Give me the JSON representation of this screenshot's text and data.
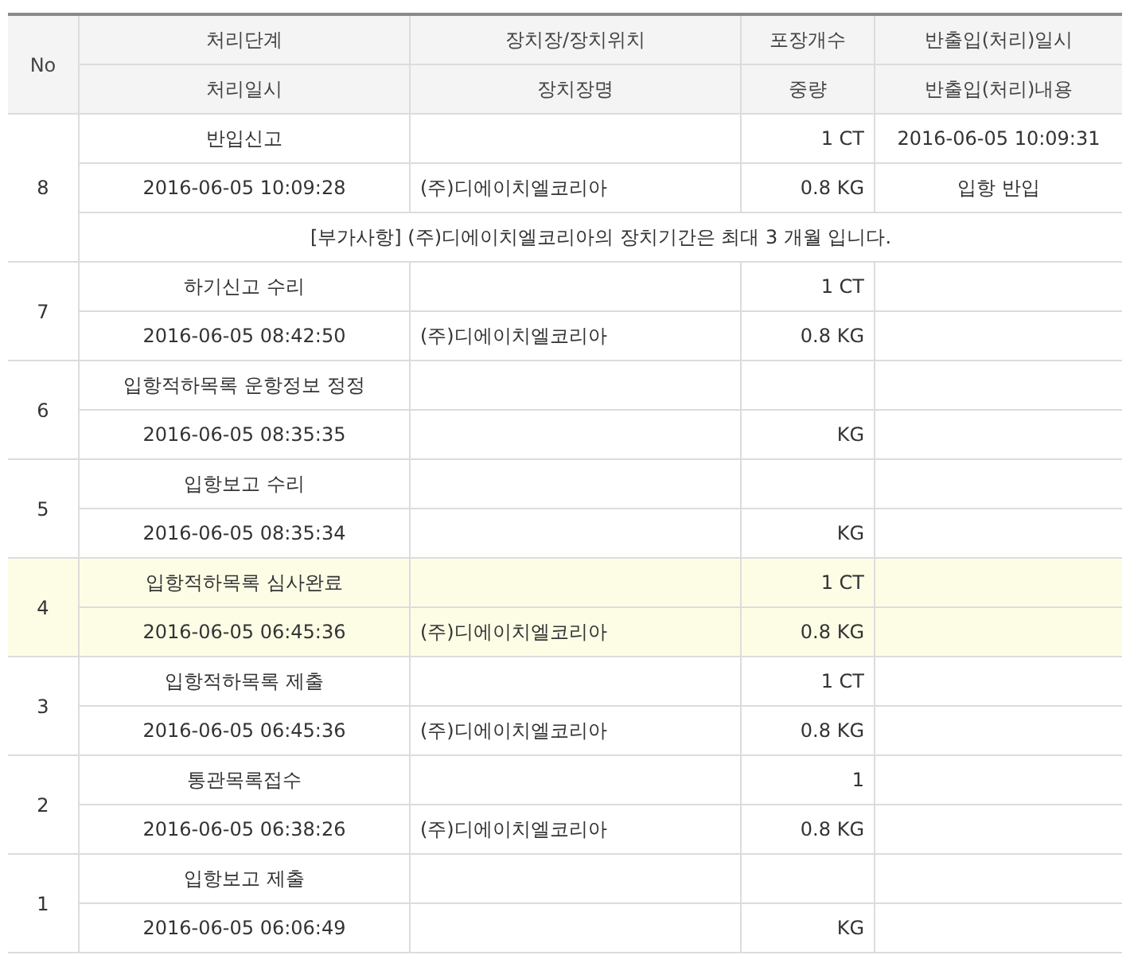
{
  "header": {
    "no": "No",
    "row1": [
      "처리단계",
      "장치장/장치위치",
      "포장개수",
      "반출입(처리)일시"
    ],
    "row2": [
      "처리일시",
      "장치장명",
      "중량",
      "반출입(처리)내용"
    ]
  },
  "rows": [
    {
      "no": "8",
      "stage": "반입신고",
      "time": "2016-06-05 10:09:28",
      "warehouse": "(주)디에이치엘코리아",
      "count": "1 CT",
      "weight": "0.8 KG",
      "io_time": "2016-06-05 10:09:31",
      "io_content": "입항 반입",
      "note": "[부가사항] (주)디에이치엘코리아의 장치기간은 최대 3 개월 입니다.",
      "highlighted": false
    },
    {
      "no": "7",
      "stage": "하기신고 수리",
      "time": "2016-06-05 08:42:50",
      "warehouse": "(주)디에이치엘코리아",
      "count": "1 CT",
      "weight": "0.8 KG",
      "highlighted": false
    },
    {
      "no": "6",
      "stage": "입항적하목록 운항정보 정정",
      "time": "2016-06-05 08:35:35",
      "weight": "KG",
      "highlighted": false
    },
    {
      "no": "5",
      "stage": "입항보고 수리",
      "time": "2016-06-05 08:35:34",
      "weight": "KG",
      "highlighted": false
    },
    {
      "no": "4",
      "stage": "입항적하목록 심사완료",
      "time": "2016-06-05 06:45:36",
      "warehouse": "(주)디에이치엘코리아",
      "count": "1 CT",
      "weight": "0.8 KG",
      "highlighted": true
    },
    {
      "no": "3",
      "stage": "입항적하목록 제출",
      "time": "2016-06-05 06:45:36",
      "warehouse": "(주)디에이치엘코리아",
      "count": "1 CT",
      "weight": "0.8 KG",
      "highlighted": false
    },
    {
      "no": "2",
      "stage": "통관목록접수",
      "time": "2016-06-05 06:38:26",
      "warehouse": "(주)디에이치엘코리아",
      "count": "1",
      "weight": "0.8 KG",
      "highlighted": false
    },
    {
      "no": "1",
      "stage": "입항보고 제출",
      "time": "2016-06-05 06:06:49",
      "weight": "KG",
      "highlighted": false
    }
  ]
}
